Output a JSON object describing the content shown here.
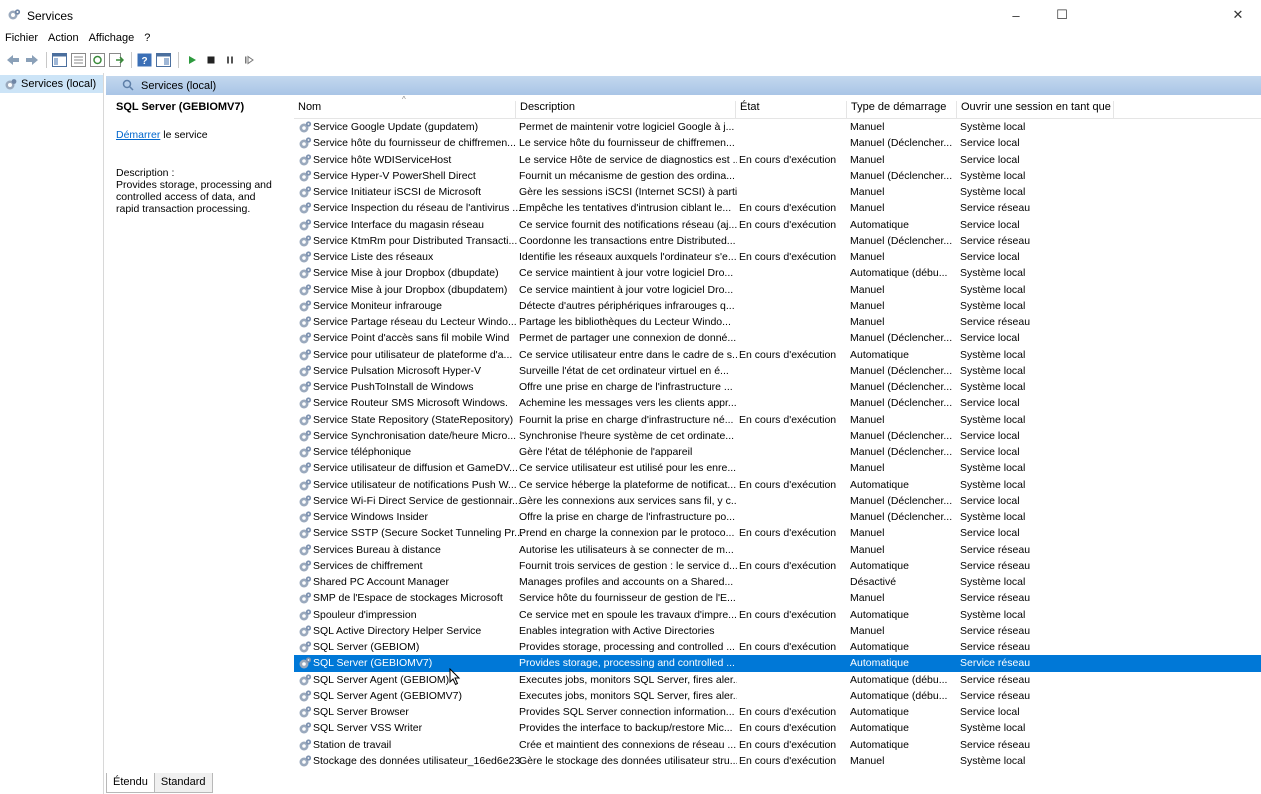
{
  "window": {
    "title": "Services",
    "minimize": "–",
    "maximize": "☐",
    "close": "✕"
  },
  "menu": [
    "Fichier",
    "Action",
    "Affichage",
    "?"
  ],
  "toolbar_icons": [
    "back-arrow-icon",
    "forward-arrow-icon",
    "show-console-tree-icon",
    "properties-icon",
    "refresh-icon",
    "export-icon",
    "help-icon",
    "console-icon",
    "start-service-icon",
    "stop-service-icon",
    "pause-service-icon",
    "resume-service-icon"
  ],
  "tree": {
    "item": "Services (local)"
  },
  "panel": {
    "header": "Services (local)"
  },
  "details": {
    "service_name": "SQL Server (GEBIOMV7)",
    "action_link": "Démarrer",
    "action_rest": " le service",
    "description_label": "Description :",
    "description_text": "Provides storage, processing and controlled access of data, and rapid transaction processing."
  },
  "table": {
    "columns": [
      "Nom",
      "Description",
      "État",
      "Type de démarrage",
      "Ouvrir une session en tant que"
    ],
    "rows": [
      {
        "name": "Service Google Update (gupdatem)",
        "desc": "Permet de maintenir votre logiciel Google à j...",
        "state": "",
        "start": "Manuel",
        "logon": "Système local"
      },
      {
        "name": "Service hôte du fournisseur de chiffremen...",
        "desc": "Le service hôte du fournisseur de chiffremen...",
        "state": "",
        "start": "Manuel (Déclencher...",
        "logon": "Service local"
      },
      {
        "name": "Service hôte WDIServiceHost",
        "desc": "Le service Hôte de service de diagnostics est ...",
        "state": "En cours d'exécution",
        "start": "Manuel",
        "logon": "Service local"
      },
      {
        "name": "Service Hyper-V PowerShell Direct",
        "desc": "Fournit un mécanisme de gestion des ordina...",
        "state": "",
        "start": "Manuel (Déclencher...",
        "logon": "Système local"
      },
      {
        "name": "Service Initiateur iSCSI de Microsoft",
        "desc": "Gère les sessions iSCSI (Internet SCSI) à partir...",
        "state": "",
        "start": "Manuel",
        "logon": "Système local"
      },
      {
        "name": "Service Inspection du réseau de l'antivirus ...",
        "desc": "Empêche les tentatives d'intrusion ciblant le...",
        "state": "En cours d'exécution",
        "start": "Manuel",
        "logon": "Service réseau"
      },
      {
        "name": "Service Interface du magasin réseau",
        "desc": "Ce service fournit des notifications réseau (aj...",
        "state": "En cours d'exécution",
        "start": "Automatique",
        "logon": "Service local"
      },
      {
        "name": "Service KtmRm pour Distributed Transacti...",
        "desc": "Coordonne les transactions entre Distributed...",
        "state": "",
        "start": "Manuel (Déclencher...",
        "logon": "Service réseau"
      },
      {
        "name": "Service Liste des réseaux",
        "desc": "Identifie les réseaux auxquels l'ordinateur s'e...",
        "state": "En cours d'exécution",
        "start": "Manuel",
        "logon": "Service local"
      },
      {
        "name": "Service Mise à jour Dropbox (dbupdate)",
        "desc": "Ce service maintient à jour votre logiciel Dro...",
        "state": "",
        "start": "Automatique (débu...",
        "logon": "Système local"
      },
      {
        "name": "Service Mise à jour Dropbox (dbupdatem)",
        "desc": "Ce service maintient à jour votre logiciel Dro...",
        "state": "",
        "start": "Manuel",
        "logon": "Système local"
      },
      {
        "name": "Service Moniteur infrarouge",
        "desc": "Détecte d'autres périphériques infrarouges q...",
        "state": "",
        "start": "Manuel",
        "logon": "Système local"
      },
      {
        "name": "Service Partage réseau du Lecteur Windo...",
        "desc": "Partage les bibliothèques du Lecteur Windo...",
        "state": "",
        "start": "Manuel",
        "logon": "Service réseau"
      },
      {
        "name": "Service Point d'accès sans fil mobile Wind",
        "desc": "Permet de partager une connexion de donné...",
        "state": "",
        "start": "Manuel (Déclencher...",
        "logon": "Service local"
      },
      {
        "name": "Service pour utilisateur de plateforme d'a...",
        "desc": "Ce service utilisateur entre dans le cadre de s...",
        "state": "En cours d'exécution",
        "start": "Automatique",
        "logon": "Système local"
      },
      {
        "name": "Service Pulsation Microsoft Hyper-V",
        "desc": "Surveille l'état de cet ordinateur virtuel en é...",
        "state": "",
        "start": "Manuel (Déclencher...",
        "logon": "Système local"
      },
      {
        "name": "Service PushToInstall de Windows",
        "desc": "Offre une prise en charge de l'infrastructure ...",
        "state": "",
        "start": "Manuel (Déclencher...",
        "logon": "Système local"
      },
      {
        "name": "Service Routeur SMS Microsoft Windows.",
        "desc": "Achemine les messages vers les clients appr...",
        "state": "",
        "start": "Manuel (Déclencher...",
        "logon": "Service local"
      },
      {
        "name": "Service State Repository (StateRepository)",
        "desc": "Fournit la prise en charge d'infrastructure né...",
        "state": "En cours d'exécution",
        "start": "Manuel",
        "logon": "Système local"
      },
      {
        "name": "Service Synchronisation date/heure Micro...",
        "desc": "Synchronise l'heure système de cet ordinate...",
        "state": "",
        "start": "Manuel (Déclencher...",
        "logon": "Service local"
      },
      {
        "name": "Service téléphonique",
        "desc": "Gère l'état de téléphonie de l'appareil",
        "state": "",
        "start": "Manuel (Déclencher...",
        "logon": "Service local"
      },
      {
        "name": "Service utilisateur de diffusion et GameDV...",
        "desc": "Ce service utilisateur est utilisé pour les enre...",
        "state": "",
        "start": "Manuel",
        "logon": "Système local"
      },
      {
        "name": "Service utilisateur de notifications Push W...",
        "desc": "Ce service héberge la plateforme de notificat...",
        "state": "En cours d'exécution",
        "start": "Automatique",
        "logon": "Système local"
      },
      {
        "name": "Service Wi-Fi Direct Service de gestionnair...",
        "desc": "Gère les connexions aux services sans fil, y c...",
        "state": "",
        "start": "Manuel (Déclencher...",
        "logon": "Service local"
      },
      {
        "name": "Service Windows Insider",
        "desc": "Offre la prise en charge de l'infrastructure po...",
        "state": "",
        "start": "Manuel (Déclencher...",
        "logon": "Système local"
      },
      {
        "name": "Service SSTP (Secure Socket Tunneling Pr...",
        "desc": "Prend en charge la connexion par le protoco...",
        "state": "En cours d'exécution",
        "start": "Manuel",
        "logon": "Service local"
      },
      {
        "name": "Services Bureau à distance",
        "desc": "Autorise les utilisateurs à se connecter de m...",
        "state": "",
        "start": "Manuel",
        "logon": "Service réseau"
      },
      {
        "name": "Services de chiffrement",
        "desc": "Fournit trois services de gestion : le service d...",
        "state": "En cours d'exécution",
        "start": "Automatique",
        "logon": "Service réseau"
      },
      {
        "name": "Shared PC Account Manager",
        "desc": "Manages profiles and accounts on a Shared...",
        "state": "",
        "start": "Désactivé",
        "logon": "Système local"
      },
      {
        "name": "SMP de l'Espace de stockages Microsoft",
        "desc": "Service hôte du fournisseur de gestion de l'E...",
        "state": "",
        "start": "Manuel",
        "logon": "Service réseau"
      },
      {
        "name": "Spouleur d'impression",
        "desc": "Ce service met en spoule les travaux d'impre...",
        "state": "En cours d'exécution",
        "start": "Automatique",
        "logon": "Système local"
      },
      {
        "name": "SQL Active Directory Helper Service",
        "desc": "Enables integration with Active Directories",
        "state": "",
        "start": "Manuel",
        "logon": "Service réseau"
      },
      {
        "name": "SQL Server (GEBIOM)",
        "desc": "Provides storage, processing and controlled ...",
        "state": "En cours d'exécution",
        "start": "Automatique",
        "logon": "Service réseau"
      },
      {
        "name": "SQL Server (GEBIOMV7)",
        "desc": "Provides storage, processing and controlled ...",
        "state": "",
        "start": "Automatique",
        "logon": "Service réseau",
        "selected": true
      },
      {
        "name": "SQL Server Agent (GEBIOM)",
        "desc": "Executes jobs, monitors SQL Server, fires aler...",
        "state": "",
        "start": "Automatique (débu...",
        "logon": "Service réseau"
      },
      {
        "name": "SQL Server Agent (GEBIOMV7)",
        "desc": "Executes jobs, monitors SQL Server, fires aler...",
        "state": "",
        "start": "Automatique (débu...",
        "logon": "Service réseau"
      },
      {
        "name": "SQL Server Browser",
        "desc": "Provides SQL Server connection information...",
        "state": "En cours d'exécution",
        "start": "Automatique",
        "logon": "Service local"
      },
      {
        "name": "SQL Server VSS Writer",
        "desc": "Provides the interface to backup/restore Mic...",
        "state": "En cours d'exécution",
        "start": "Automatique",
        "logon": "Système local"
      },
      {
        "name": "Station de travail",
        "desc": "Crée et maintient des connexions de réseau ...",
        "state": "En cours d'exécution",
        "start": "Automatique",
        "logon": "Service réseau"
      },
      {
        "name": "Stockage des données utilisateur_16ed6e23",
        "desc": "Gère le stockage des données utilisateur stru...",
        "state": "En cours d'exécution",
        "start": "Manuel",
        "logon": "Système local"
      }
    ]
  },
  "tabs": [
    "Étendu",
    "Standard"
  ],
  "colors": {
    "selection": "#0078d7",
    "panel_header": "#b8d0ec",
    "link": "#0066cc"
  }
}
